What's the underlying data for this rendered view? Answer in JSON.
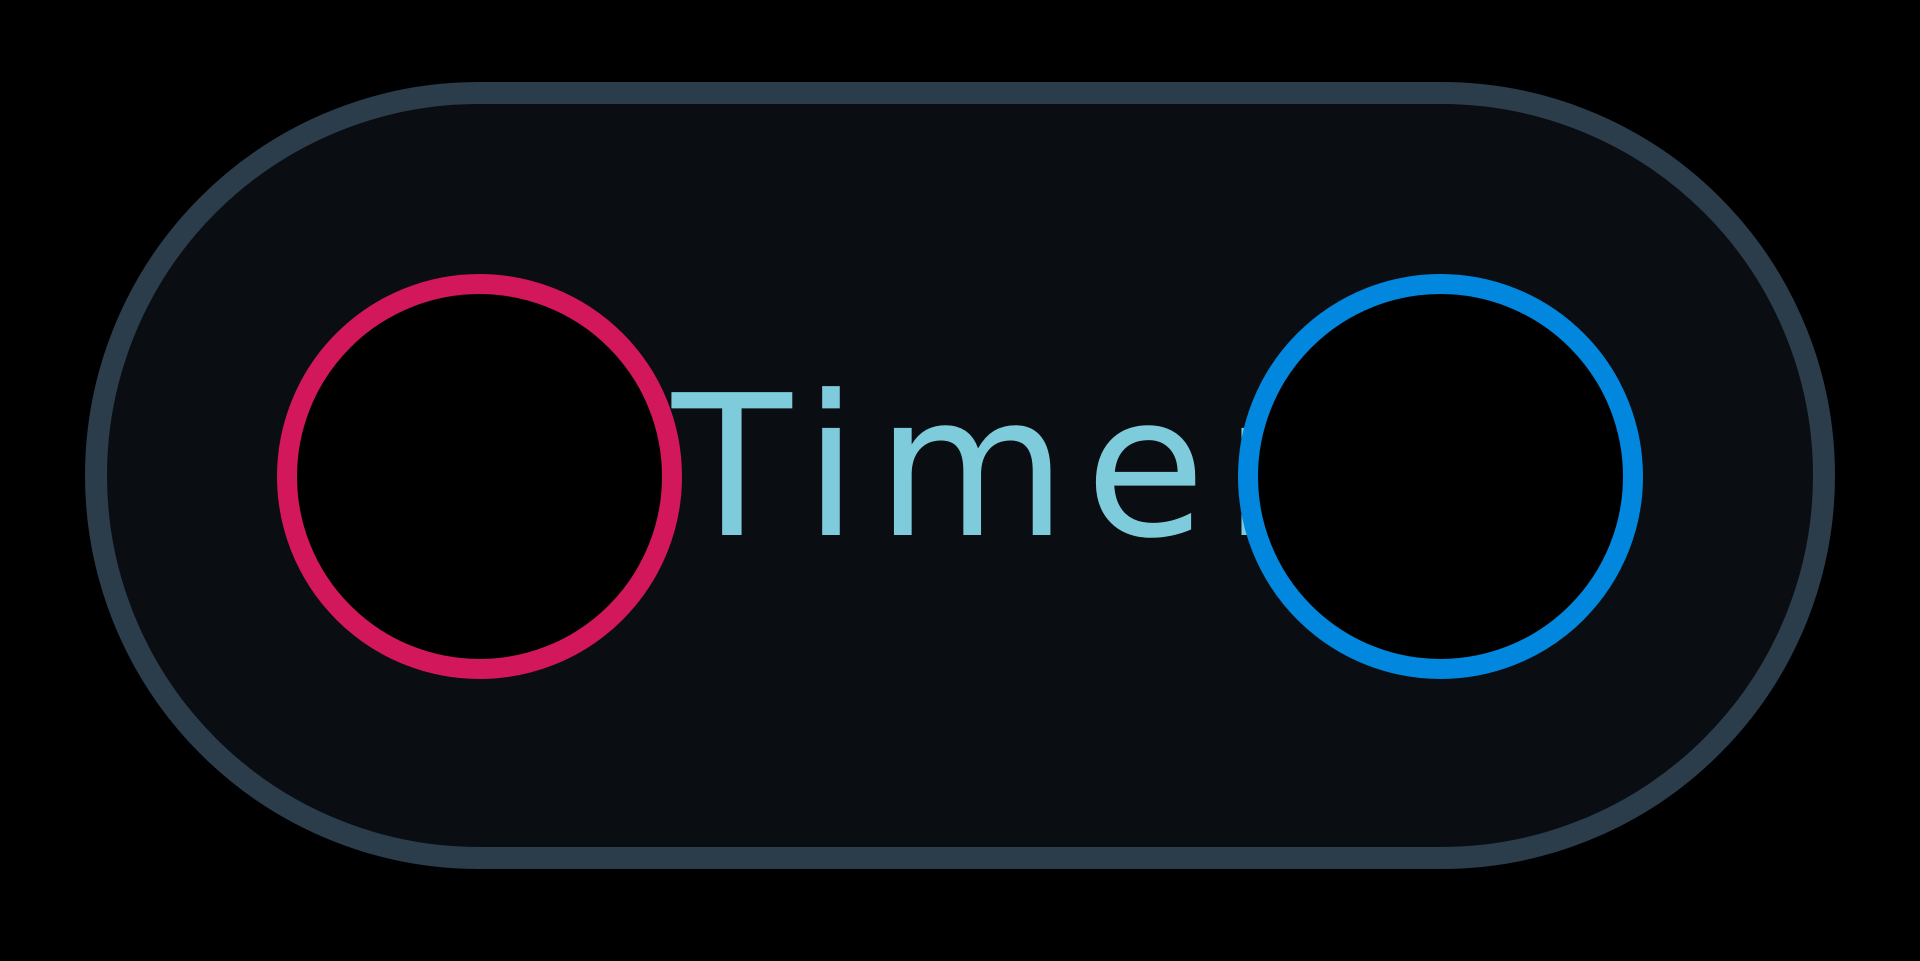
{
  "timer": {
    "label": "Timer",
    "colors": {
      "text": "#7ecbdc",
      "left_ring": "#d2175b",
      "right_ring": "#0187de",
      "border": "#2b3c4b",
      "background": "#0a0d12"
    },
    "left_ring_icon": "circle-outline-icon",
    "right_ring_icon": "circle-outline-icon"
  }
}
